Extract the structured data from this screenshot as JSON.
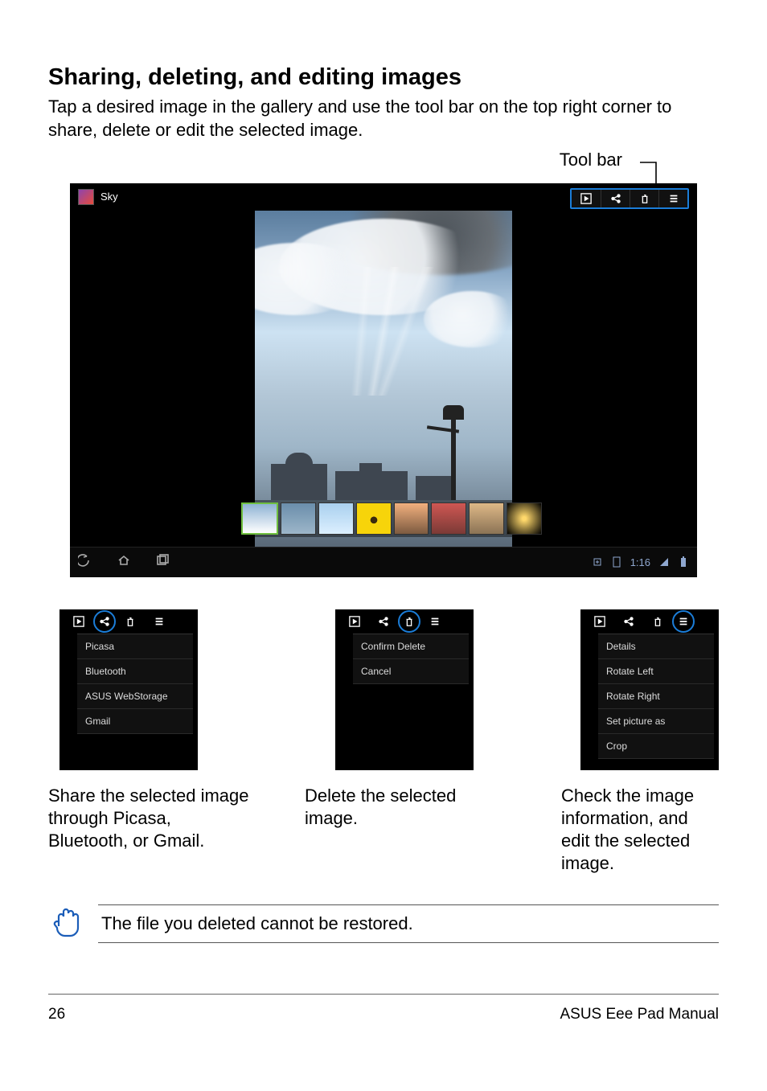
{
  "heading": "Sharing, deleting, and editing images",
  "intro": "Tap a desired image in the gallery and use the tool bar on the top right corner to share, delete or edit the selected image.",
  "toolbar_label": "Tool bar",
  "main_shot": {
    "album_title": "Sky",
    "status_time": "1:16"
  },
  "panels": {
    "share": {
      "items": [
        "Picasa",
        "Bluetooth",
        "ASUS WebStorage",
        "Gmail"
      ],
      "caption": "Share the selected image through Picasa, Bluetooth, or Gmail."
    },
    "delete": {
      "items": [
        "Confirm Delete",
        "Cancel"
      ],
      "caption": "Delete the selected image."
    },
    "overflow": {
      "items": [
        "Details",
        "Rotate Left",
        "Rotate Right",
        "Set picture as",
        "Crop"
      ],
      "caption": "Check the image information, and edit the selected image."
    }
  },
  "note": "The file you deleted cannot be restored.",
  "footer": {
    "page": "26",
    "manual": "ASUS Eee Pad Manual"
  }
}
